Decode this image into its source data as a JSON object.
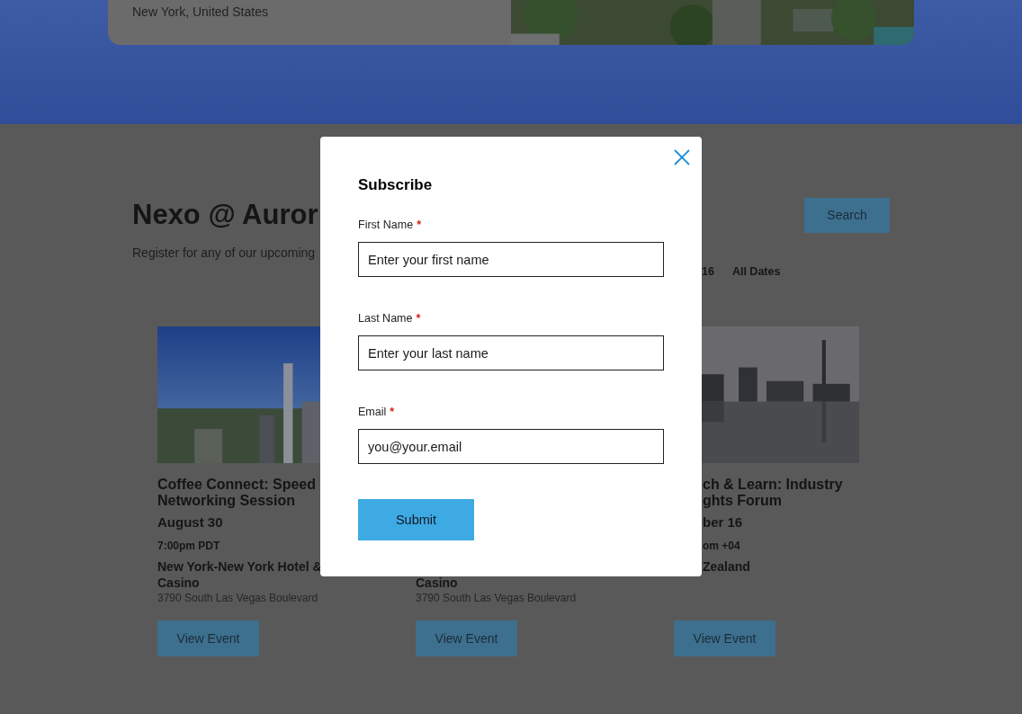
{
  "hero": {
    "location": "New York, United States"
  },
  "page": {
    "title": "Nexo @ Auror",
    "subtitle": "Register for any of our upcoming",
    "search_button": "Search",
    "date_filters": [
      "16",
      "All Dates"
    ]
  },
  "events": [
    {
      "title": "Coffee Connect: Speed Networking Session",
      "date": "August 30",
      "time": "7:00pm PDT",
      "venue": "New York-New York Hotel & Casino",
      "address": "3790 South Las Vegas Boulevard",
      "button": "View Event"
    },
    {
      "venue": "Casino",
      "address": "3790 South Las Vegas Boulevard",
      "button": "View Event"
    },
    {
      "title": "ch & Learn: Industry ghts Forum",
      "date": "ber 16",
      "time": "om +04",
      "venue": "Zealand",
      "button": "View Event"
    }
  ],
  "modal": {
    "title": "Subscribe",
    "fields": [
      {
        "label": "First Name",
        "required_mark": "*",
        "placeholder": "Enter your first name"
      },
      {
        "label": "Last Name",
        "required_mark": "*",
        "placeholder": "Enter your last name"
      },
      {
        "label": "Email",
        "required_mark": "*",
        "placeholder": "you@your.email"
      }
    ],
    "submit": "Submit"
  }
}
